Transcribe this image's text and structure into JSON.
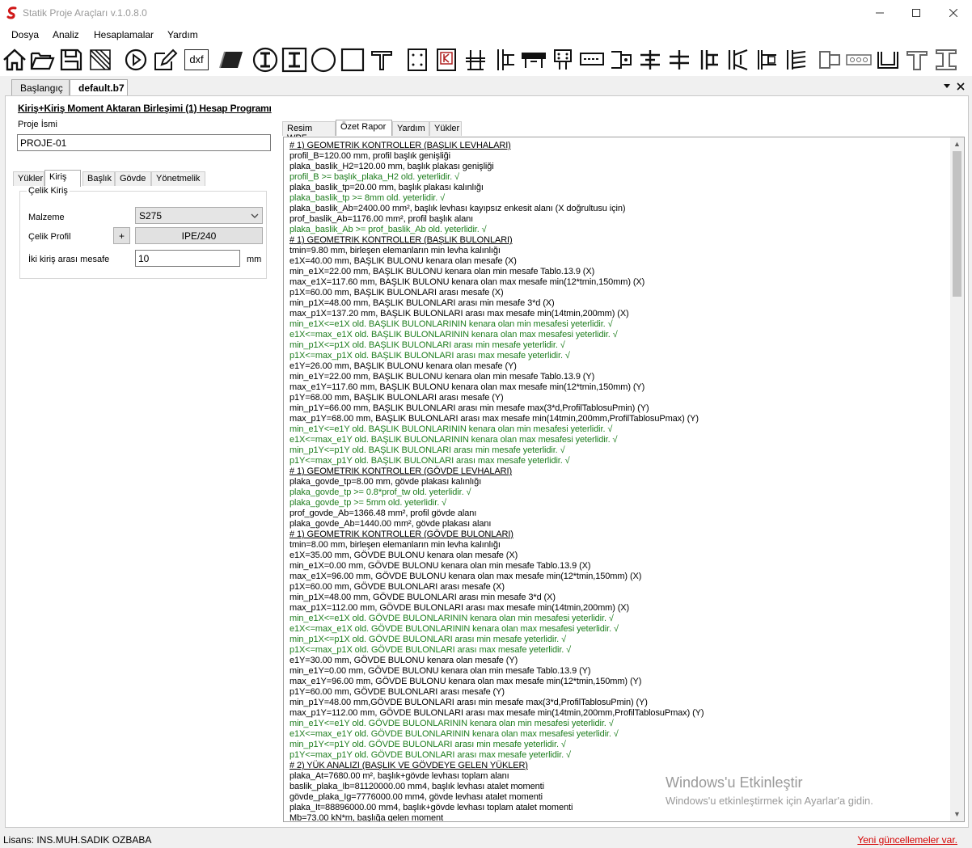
{
  "window": {
    "title": "Statik Proje Araçları v.1.0.8.0",
    "controls": [
      "minimize",
      "maximize",
      "close"
    ]
  },
  "menu": [
    "Dosya",
    "Analiz",
    "Hesaplamalar",
    "Yardım"
  ],
  "toolbar": {
    "icons": [
      "home-icon",
      "open-folder-icon",
      "save-icon",
      "stamp-icon",
      "play-icon",
      "edit-icon",
      "dxf-icon",
      "layer-icon",
      "i-section-circle-icon",
      "i-section-square-icon",
      "circle-section-icon",
      "square-section-icon",
      "t-section-icon",
      "plate-bolts-icon",
      "k-plate-icon",
      "beam-column-connection-icon",
      "end-plate-icon",
      "splice-icon",
      "bolt-plate-icon",
      "base-plate-icon",
      "column-icon",
      "beam-icon",
      "moment-connection-icon",
      "moment-connection-2-icon",
      "stiffened-connection-icon",
      "stair-connection-icon",
      "purlin-icon",
      "bolt-row-icon",
      "u-channel-icon",
      "t-channel-icon",
      "h-channel-icon"
    ],
    "dxf_label": "dxf"
  },
  "doc_tabs": [
    {
      "label": "Başlangıç",
      "active": false
    },
    {
      "label": "default.b7",
      "active": true
    }
  ],
  "left": {
    "program_title": "Kiriş+Kiriş Moment Aktaran Birleşimi (1) Hesap Programı",
    "project_label": "Proje İsmi",
    "project_value": "PROJE-01",
    "tabs": [
      "Yükler",
      "Kiriş",
      "Başlık",
      "Gövde",
      "Yönetmelik"
    ],
    "active_tab": "Kiriş",
    "group_title": "Çelik Kiriş",
    "material_label": "Malzeme",
    "material_value": "S275",
    "profile_label": "Çelik Profil",
    "profile_plus": "+",
    "profile_value": "IPE/240",
    "distance_label": "İki kiriş arası mesafe",
    "distance_value": "10",
    "distance_unit": "mm"
  },
  "right": {
    "tabs": [
      "Resim WPF",
      "Özet Rapor",
      "Yardım",
      "Yükler"
    ],
    "active_tab": "Özet Rapor",
    "lines": [
      {
        "t": "# 1) GEOMETRIK KONTROLLER (BAŞLIK LEVHALARI)",
        "k": "h"
      },
      {
        "t": "profil_B=120.00 mm, profil başlık genişliği",
        "k": ""
      },
      {
        "t": "plaka_baslik_H2=120.00 mm, başlık plakası genişliği",
        "k": ""
      },
      {
        "t": "profil_B >= başlık_plaka_H2 old. yeterlidir. √",
        "k": "ok"
      },
      {
        "t": "plaka_baslik_tp=20.00 mm, başlık plakası kalınlığı",
        "k": ""
      },
      {
        "t": "plaka_baslik_tp >= 8mm old. yeterlidir. √",
        "k": "ok"
      },
      {
        "t": "plaka_baslik_Ab=2400.00 mm², başlık levhası kayıpsız enkesit alanı (X doğrultusu için)",
        "k": ""
      },
      {
        "t": "prof_baslik_Ab=1176.00 mm², profil başlık alanı",
        "k": ""
      },
      {
        "t": "plaka_baslik_Ab >= prof_baslik_Ab old. yeterlidir. √",
        "k": "ok"
      },
      {
        "t": "# 1) GEOMETRIK KONTROLLER (BAŞLIK BULONLARI)",
        "k": "h"
      },
      {
        "t": "tmin=9.80 mm, birleşen elemanların min levha kalınlığı",
        "k": ""
      },
      {
        "t": "e1X=40.00 mm, BAŞLIK BULONU kenara olan mesafe (X)",
        "k": ""
      },
      {
        "t": "min_e1X=22.00 mm, BAŞLIK BULONU kenara olan min mesafe Tablo.13.9 (X)",
        "k": ""
      },
      {
        "t": "max_e1X=117.60 mm, BAŞLIK BULONU kenara olan max mesafe min(12*tmin,150mm) (X)",
        "k": ""
      },
      {
        "t": "p1X=60.00 mm, BAŞLIK BULONLARI arası mesafe (X)",
        "k": ""
      },
      {
        "t": "min_p1X=48.00 mm, BAŞLIK BULONLARI arası min mesafe 3*d (X)",
        "k": ""
      },
      {
        "t": "max_p1X=137.20 mm, BAŞLIK BULONLARI arası max mesafe min(14tmin,200mm) (X)",
        "k": ""
      },
      {
        "t": "min_e1X<=e1X old. BAŞLIK BULONLARININ kenara olan min mesafesi yeterlidir. √",
        "k": "ok"
      },
      {
        "t": "e1X<=max_e1X old. BAŞLIK BULONLARININ kenara olan max mesafesi yeterlidir. √",
        "k": "ok"
      },
      {
        "t": "min_p1X<=p1X old. BAŞLIK BULONLARI arası min mesafe yeterlidir. √",
        "k": "ok"
      },
      {
        "t": "p1X<=max_p1X old. BAŞLIK BULONLARI arası max mesafe yeterlidir. √",
        "k": "ok"
      },
      {
        "t": "e1Y=26.00 mm, BAŞLIK BULONU kenara olan mesafe (Y)",
        "k": ""
      },
      {
        "t": "min_e1Y=22.00 mm, BAŞLIK BULONU kenara olan min mesafe Tablo.13.9 (Y)",
        "k": ""
      },
      {
        "t": "max_e1Y=117.60 mm, BAŞLIK BULONU kenara olan max mesafe min(12*tmin,150mm) (Y)",
        "k": ""
      },
      {
        "t": "p1Y=68.00 mm, BAŞLIK BULONLARI arası mesafe (Y)",
        "k": ""
      },
      {
        "t": "min_p1Y=66.00 mm, BAŞLIK BULONLARI arası min mesafe max(3*d,ProfilTablosuPmin) (Y)",
        "k": ""
      },
      {
        "t": "max_p1Y=68.00 mm, BAŞLIK BULONLARI arası max mesafe min(14tmin,200mm,ProfilTablosuPmax) (Y)",
        "k": ""
      },
      {
        "t": "min_e1Y<=e1Y old. BAŞLIK BULONLARININ kenara olan min mesafesi yeterlidir. √",
        "k": "ok"
      },
      {
        "t": "e1X<=max_e1Y old. BAŞLIK BULONLARININ kenara olan max mesafesi yeterlidir. √",
        "k": "ok"
      },
      {
        "t": "min_p1Y<=p1Y old. BAŞLIK BULONLARI arası min mesafe yeterlidir. √",
        "k": "ok"
      },
      {
        "t": "p1Y<=max_p1Y old. BAŞLIK BULONLARI arası max mesafe yeterlidir. √",
        "k": "ok"
      },
      {
        "t": "# 1) GEOMETRIK KONTROLLER (GÖVDE LEVHALARI)",
        "k": "h"
      },
      {
        "t": "plaka_govde_tp=8.00 mm, gövde plakası kalınlığı",
        "k": ""
      },
      {
        "t": "plaka_govde_tp >= 0.8*prof_tw old. yeterlidir. √",
        "k": "ok"
      },
      {
        "t": "plaka_govde_tp >= 5mm old. yeterlidir. √",
        "k": "ok"
      },
      {
        "t": "prof_govde_Ab=1366.48 mm², profil gövde alanı",
        "k": ""
      },
      {
        "t": "plaka_govde_Ab=1440.00 mm², gövde plakası alanı",
        "k": ""
      },
      {
        "t": "# 1) GEOMETRIK KONTROLLER (GÖVDE BULONLARI)",
        "k": "h"
      },
      {
        "t": "tmin=8.00 mm, birleşen elemanların min levha kalınlığı",
        "k": ""
      },
      {
        "t": "e1X=35.00 mm, GÖVDE BULONU kenara olan mesafe (X)",
        "k": ""
      },
      {
        "t": "min_e1X=0.00 mm, GÖVDE BULONU kenara olan min mesafe Tablo.13.9 (X)",
        "k": ""
      },
      {
        "t": "max_e1X=96.00 mm, GÖVDE BULONU kenara olan max mesafe min(12*tmin,150mm) (X)",
        "k": ""
      },
      {
        "t": "p1X=60.00 mm, GÖVDE BULONLARI arası mesafe (X)",
        "k": ""
      },
      {
        "t": "min_p1X=48.00 mm, GÖVDE BULONLARI arası min mesafe 3*d (X)",
        "k": ""
      },
      {
        "t": "max_p1X=112.00 mm, GÖVDE BULONLARI arası max mesafe min(14tmin,200mm) (X)",
        "k": ""
      },
      {
        "t": "min_e1X<=e1X old. GÖVDE BULONLARININ kenara olan min mesafesi yeterlidir. √",
        "k": "ok"
      },
      {
        "t": "e1X<=max_e1X old. GÖVDE BULONLARININ kenara olan max mesafesi yeterlidir. √",
        "k": "ok"
      },
      {
        "t": "min_p1X<=p1X old. GÖVDE BULONLARI arası min mesafe yeterlidir. √",
        "k": "ok"
      },
      {
        "t": "p1X<=max_p1X old. GÖVDE BULONLARI arası max mesafe yeterlidir. √",
        "k": "ok"
      },
      {
        "t": "e1Y=30.00 mm, GÖVDE BULONU kenara olan mesafe (Y)",
        "k": ""
      },
      {
        "t": "min_e1Y=0.00 mm, GÖVDE BULONU kenara olan min mesafe Tablo.13.9 (Y)",
        "k": ""
      },
      {
        "t": "max_e1Y=96.00 mm, GÖVDE BULONU kenara olan max mesafe min(12*tmin,150mm) (Y)",
        "k": ""
      },
      {
        "t": "p1Y=60.00 mm, GÖVDE BULONLARI arası mesafe (Y)",
        "k": ""
      },
      {
        "t": "min_p1Y=48.00 mm,GÖVDE BULONLARI arası min mesafe max(3*d,ProfilTablosuPmin) (Y)",
        "k": ""
      },
      {
        "t": "max_p1Y=112.00 mm, GÖVDE BULONLARI arası max mesafe min(14tmin,200mm,ProfilTablosuPmax) (Y)",
        "k": ""
      },
      {
        "t": "min_e1Y<=e1Y old. GÖVDE BULONLARININ kenara olan min mesafesi yeterlidir. √",
        "k": "ok"
      },
      {
        "t": "e1X<=max_e1Y old. GÖVDE BULONLARININ kenara olan max mesafesi yeterlidir. √",
        "k": "ok"
      },
      {
        "t": "min_p1Y<=p1Y old. GÖVDE BULONLARI arası min mesafe yeterlidir. √",
        "k": "ok"
      },
      {
        "t": "p1Y<=max_p1Y old. GÖVDE BULONLARI arası max mesafe yeterlidir. √",
        "k": "ok"
      },
      {
        "t": "# 2) YÜK ANALIZI (BAŞLIK VE GÖVDEYE GELEN YÜKLER)",
        "k": "h"
      },
      {
        "t": "plaka_At=7680.00 m², başlık+gövde levhası toplam alanı",
        "k": ""
      },
      {
        "t": "baslik_plaka_Ib=81120000.00 mm4, başlık levhası atalet momenti",
        "k": ""
      },
      {
        "t": "gövde_plaka_Ig=7776000.00 mm4, gövde levhası atalet momenti",
        "k": ""
      },
      {
        "t": "plaka_It=88896000.00 mm4, başlık+gövde levhası toplam atalet momenti",
        "k": ""
      },
      {
        "t": "Mb=73.00 kN*m, başlığa gelen moment",
        "k": ""
      }
    ]
  },
  "watermark": {
    "title": "Windows'u Etkinleştir",
    "subtitle": "Windows'u etkinleştirmek için Ayarlar'a gidin."
  },
  "status": {
    "license": "Lisans: INS.MUH.SADIK OZBABA",
    "update_link": "Yeni güncellemeler var."
  }
}
